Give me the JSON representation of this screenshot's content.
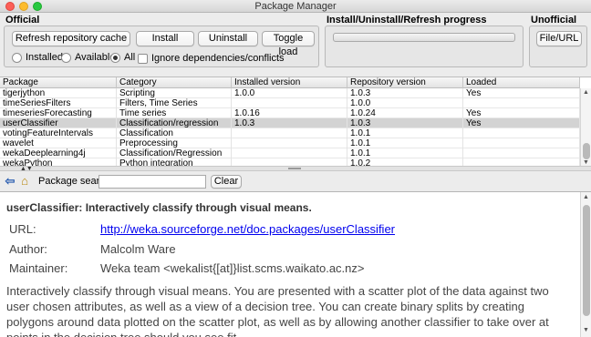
{
  "window": {
    "title": "Package Manager"
  },
  "panels": {
    "official": {
      "label": "Official",
      "buttons": {
        "refresh": "Refresh repository cache",
        "install": "Install",
        "uninstall": "Uninstall",
        "toggle_load": "Toggle load"
      },
      "filter": {
        "installed": "Installed",
        "available": "Available",
        "all": "All",
        "selected": "All"
      },
      "ignore_deps": {
        "label": "Ignore dependencies/conflicts",
        "checked": false
      }
    },
    "progress": {
      "label": "Install/Uninstall/Refresh progress",
      "value": 0
    },
    "unofficial": {
      "label": "Unofficial",
      "button": "File/URL"
    }
  },
  "table": {
    "columns": [
      "Package",
      "Category",
      "Installed version",
      "Repository version",
      "Loaded"
    ],
    "rows": [
      {
        "package": "tigerjython",
        "category": "Scripting",
        "installed": "1.0.0",
        "repository": "1.0.3",
        "loaded": "Yes"
      },
      {
        "package": "timeSeriesFilters",
        "category": "Filters, Time Series",
        "installed": "",
        "repository": "1.0.0",
        "loaded": ""
      },
      {
        "package": "timeseriesForecasting",
        "category": "Time series",
        "installed": "1.0.16",
        "repository": "1.0.24",
        "loaded": "Yes"
      },
      {
        "package": "userClassifier",
        "category": "Classification/regression",
        "installed": "1.0.3",
        "repository": "1.0.3",
        "loaded": "Yes"
      },
      {
        "package": "votingFeatureIntervals",
        "category": "Classification",
        "installed": "",
        "repository": "1.0.1",
        "loaded": ""
      },
      {
        "package": "wavelet",
        "category": "Preprocessing",
        "installed": "",
        "repository": "1.0.1",
        "loaded": ""
      },
      {
        "package": "wekaDeeplearning4j",
        "category": "Classification/Regression",
        "installed": "",
        "repository": "1.0.1",
        "loaded": ""
      },
      {
        "package": "wekaPython",
        "category": "Python integration",
        "installed": "",
        "repository": "1.0.2",
        "loaded": ""
      }
    ],
    "selected_package": "userClassifier"
  },
  "search": {
    "label": "Package search",
    "value": "",
    "clear": "Clear"
  },
  "info": {
    "title": "userClassifier: Interactively classify through visual means.",
    "url_label": "URL:",
    "url": "http://weka.sourceforge.net/doc.packages/userClassifier",
    "author_label": "Author:",
    "author": "Malcolm Ware",
    "maintainer_label": "Maintainer:",
    "maintainer": "Weka team <wekalist{[at]}list.scms.waikato.ac.nz>",
    "description": "Interactively classify through visual means. You are presented with a scatter plot of the data against two user chosen attributes, as well as a view of a decision tree. You can create binary splits by creating polygons around data plotted on the scatter plot, as well as by allowing another classifier to take over at points in the decision tree should you see fit."
  },
  "icons": {
    "back": "back-arrow-icon",
    "home": "home-icon"
  }
}
